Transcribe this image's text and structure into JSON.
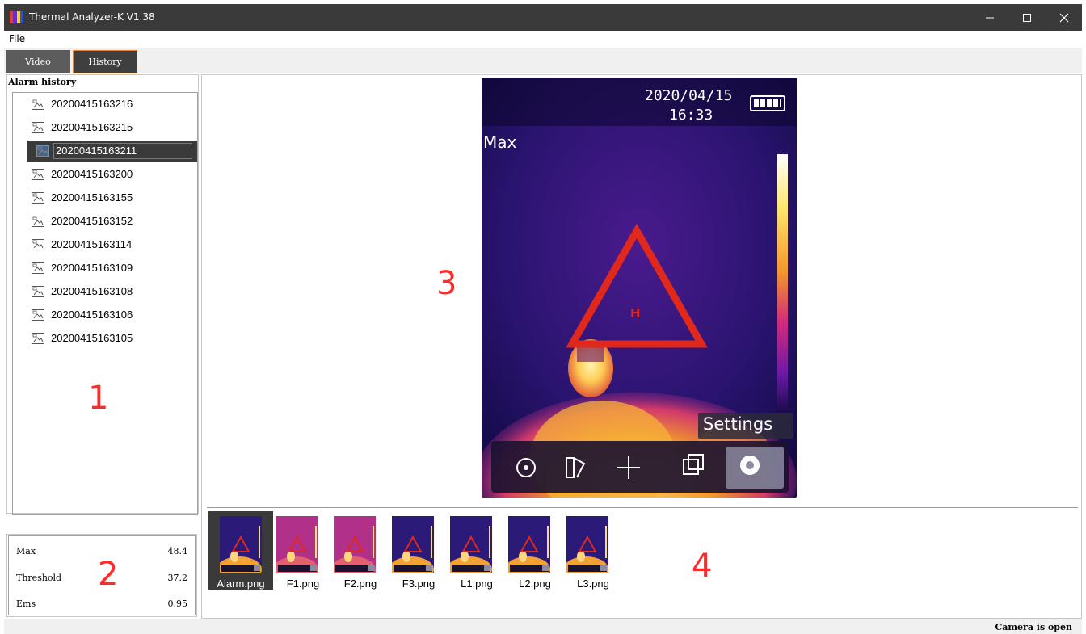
{
  "window": {
    "title": "Thermal Analyzer-K V1.38"
  },
  "menu": {
    "file": "File"
  },
  "tabs": {
    "video": "Video",
    "history": "History"
  },
  "alarm_history": {
    "title": "Alarm history",
    "items": [
      "20200415163216",
      "20200415163215",
      "20200415163211",
      "20200415163200",
      "20200415163155",
      "20200415163152",
      "20200415163114",
      "20200415163109",
      "20200415163108",
      "20200415163106",
      "20200415163105"
    ],
    "selected": "20200415163211"
  },
  "stats": {
    "max_label": "Max",
    "max_value": "48.4",
    "threshold_label": "Threshold",
    "threshold_value": "37.2",
    "ems_label": "Ems",
    "ems_value": "0.95"
  },
  "viewer": {
    "date": "2020/04/15",
    "time": "16:33",
    "max_label": "Max",
    "marker": "H",
    "settings_label": "Settings"
  },
  "thumbnails": [
    "Alarm.png",
    "F1.png",
    "F2.png",
    "F3.png",
    "L1.png",
    "L2.png",
    "L3.png"
  ],
  "annotations": {
    "n1": "1",
    "n2": "2",
    "n3": "3",
    "n4": "4"
  },
  "status": {
    "text": "Camera is open"
  },
  "colors": {
    "titlebar": "#3a3a3a",
    "accent": "#e0823a",
    "annotation": "#ff2a2a"
  }
}
